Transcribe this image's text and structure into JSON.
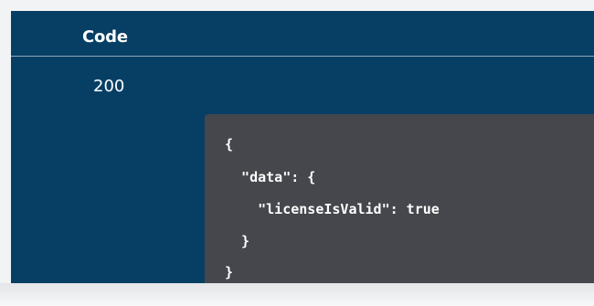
{
  "responses_table": {
    "code_header": "Code",
    "rows": [
      {
        "code": "200",
        "example_lines": [
          "{",
          "  \"data\": {",
          "    \"licenseIsValid\": true",
          "  }",
          "}"
        ]
      }
    ]
  },
  "colors": {
    "panel_background": "#073f64",
    "code_background": "#45474c",
    "text": "#ffffff"
  }
}
